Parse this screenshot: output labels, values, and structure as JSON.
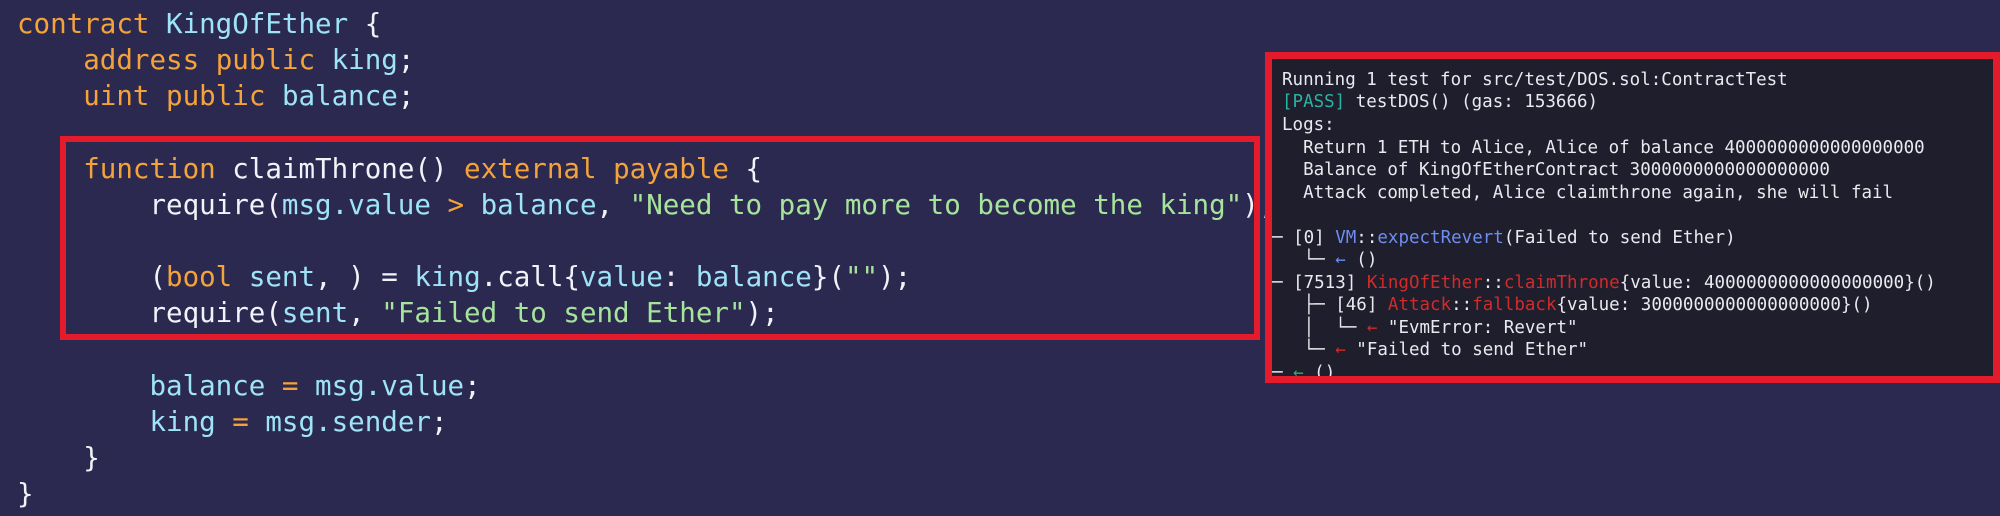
{
  "code": {
    "lines": [
      {
        "t1": "contract",
        "t2": "KingOfEther",
        "t3": " {"
      },
      {
        "t1": "address",
        "t2": "public",
        "t3": "king",
        "t4": ";"
      },
      {
        "t1": "uint",
        "t2": "public",
        "t3": "balance",
        "t4": ";"
      },
      {
        "t1": "function",
        "t2": "claimThrone()",
        "t3": "external",
        "t4": "payable",
        "t5": "{"
      },
      {
        "t1": "require(",
        "t2": "msg.value",
        "t3": ">",
        "t4": "balance",
        "t5": ", ",
        "t6": "\"Need to pay more to become the king\"",
        "t7": ");"
      },
      {
        "t1": "(",
        "t2": "bool",
        "t3": "sent",
        "t4": ", ) =",
        "t5": "king",
        "t6": ".call{",
        "t7": "value",
        "t8": ":",
        "t9": "balance",
        "t10": "}(",
        "t11": "\"\"",
        "t12": ");"
      },
      {
        "t1": "require(",
        "t2": "sent",
        "t3": ", ",
        "t4": "\"Failed to send Ether\"",
        "t5": ");"
      },
      {
        "t1": "balance",
        "t2": "=",
        "t3": "msg.value",
        "t4": ";"
      },
      {
        "t1": "king",
        "t2": "=",
        "t3": "msg.sender",
        "t4": ";"
      },
      {
        "t1": "}"
      },
      {
        "t1": "}"
      }
    ]
  },
  "terminal": {
    "l1": "Running 1 test for src/test/DOS.sol:ContractTest",
    "l2_pass": "[PASS]",
    "l2_rest": " testDOS() (gas: 153666)",
    "l3": "Logs:",
    "l4": "  Return 1 ETH to Alice, Alice of balance 4000000000000000000",
    "l5": "  Balance of KingOfEtherContract 3000000000000000000",
    "l6": "  Attack completed, Alice claimthrone again, she will fail",
    "l7_tree": "─ [0] ",
    "l7_vm": "VM",
    "l7_sep": "::",
    "l7_fn": "expectRevert",
    "l7_args": "(Failed to send Ether)",
    "l8_tree": "   └─ ",
    "l8_arrow": "←",
    "l8_val": " ()",
    "l9_tree": "─ [7513] ",
    "l9_contract": "KingOfEther",
    "l9_sep": "::",
    "l9_fn": "claimThrone",
    "l9_args": "{value: 4000000000000000000}()",
    "l10_tree": "   ├─ [46] ",
    "l10_contract": "Attack",
    "l10_sep": "::",
    "l10_fn": "fallback",
    "l10_args": "{value: 3000000000000000000}()",
    "l11_tree": "   │  └─ ",
    "l11_arrow": "←",
    "l11_val": " \"EvmError: Revert\"",
    "l12_tree": "   └─ ",
    "l12_arrow": "←",
    "l12_val": " \"Failed to send Ether\"",
    "l13_tree": "─ ",
    "l13_arrow": "←",
    "l13_val": " ()"
  },
  "colors": {
    "background": "#2b2950",
    "highlight_border": "#e31b2a",
    "keyword": "#f4a23a",
    "identifier": "#9ee3f7",
    "string": "#a6e39b",
    "terminal_bg": "#1e1e2c"
  }
}
